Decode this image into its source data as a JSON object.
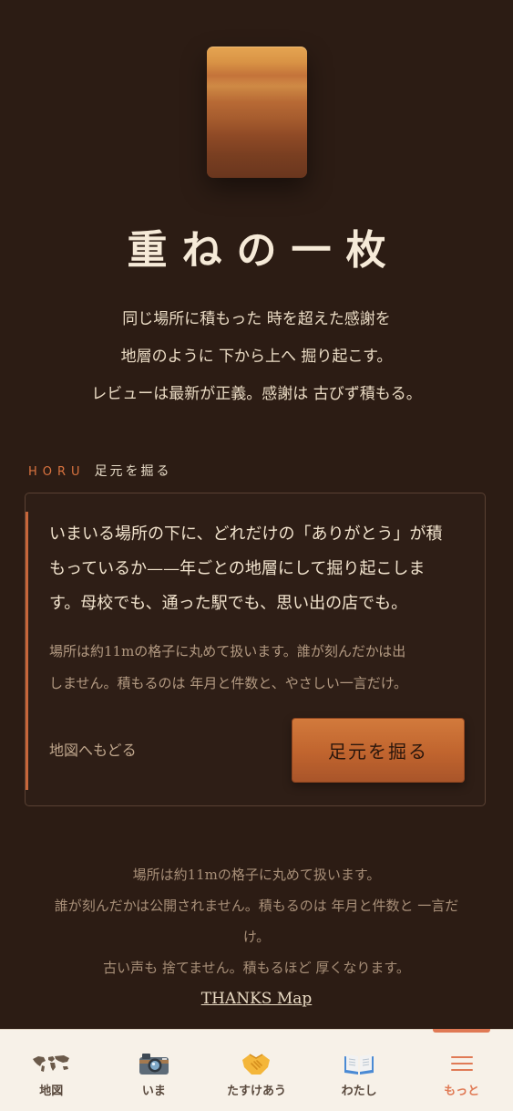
{
  "hero": {
    "title": "重ねの一枚",
    "intro_lines": [
      "同じ場所に積もった 時を超えた感謝を",
      "地層のように 下から上へ 掘り起こす。",
      "レビューは最新が正義。感謝は 古びず積もる。"
    ]
  },
  "section": {
    "label_en": "HORU",
    "label_ja": "足元を掘る"
  },
  "card": {
    "lead_lines": [
      "いまいる場所の下に、どれだけの「ありがとう」が積",
      "もっているか——年ごとの地層にして掘り起こしま",
      "す。母校でも、通った駅でも、思い出の店でも。"
    ],
    "note_lines": [
      "場所は約11mの格子に丸めて扱います。誰が刻んだかは出",
      "しません。積もるのは 年月と件数と、やさしい一言だけ。"
    ],
    "back_link": "地図へもどる",
    "dig_button": "足元を掘る"
  },
  "footer": {
    "lines": [
      "場所は約11mの格子に丸めて扱います。",
      "誰が刻んだかは公開されません。積もるのは 年月と件数と 一言だ",
      "け。",
      "古い声も 捨てません。積もるほど 厚くなります。"
    ],
    "link": "THANKS Map"
  },
  "tabbar": {
    "active": "more",
    "tabs": [
      {
        "id": "map",
        "label": "地図",
        "icon": "world-map-icon"
      },
      {
        "id": "now",
        "label": "いま",
        "icon": "camera-icon"
      },
      {
        "id": "help",
        "label": "たすけあう",
        "icon": "handshake-icon"
      },
      {
        "id": "me",
        "label": "わたし",
        "icon": "open-book-icon"
      },
      {
        "id": "more",
        "label": "もっと",
        "icon": "menu-icon"
      }
    ]
  },
  "colors": {
    "background": "#2c1c14",
    "accent": "#c8663a",
    "tab_active": "#e07a55"
  }
}
